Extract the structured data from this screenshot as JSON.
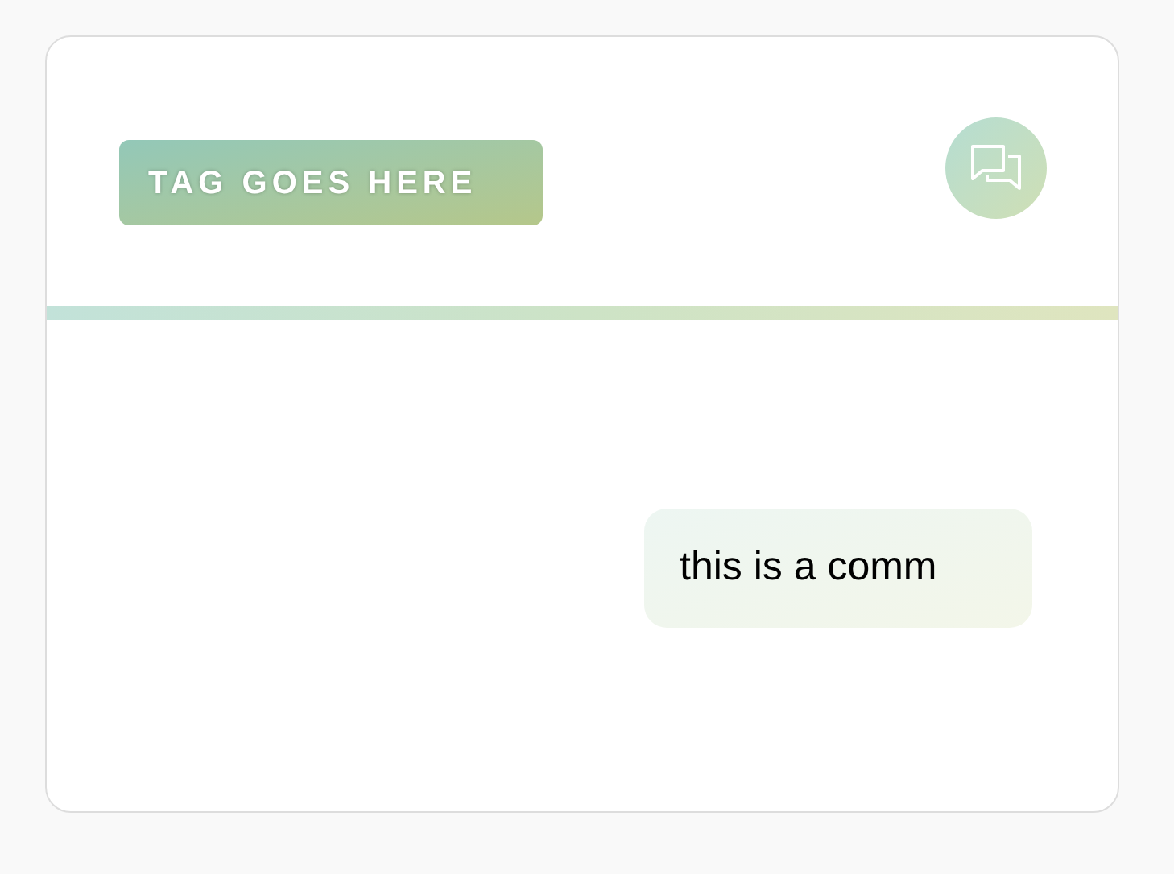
{
  "tag": {
    "label": "TAG GOES HERE"
  },
  "comment": {
    "text": "this is a comm"
  }
}
